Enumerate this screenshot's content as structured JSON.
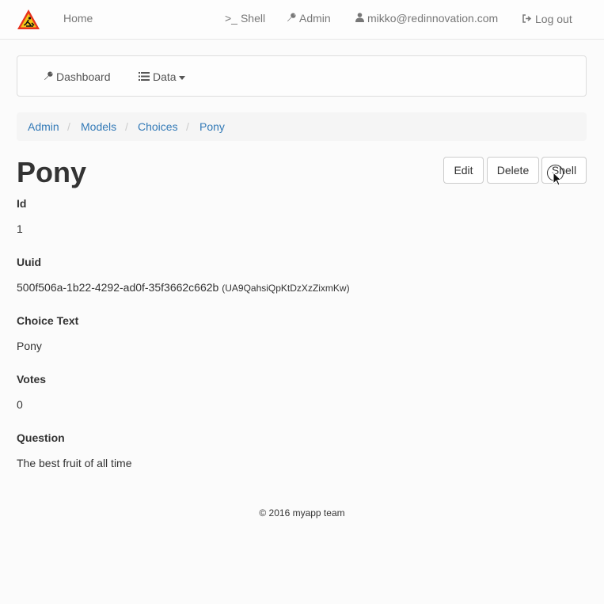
{
  "navbar": {
    "home": "Home",
    "shell": "Shell",
    "admin": "Admin",
    "user": "mikko@redinnovation.com",
    "logout": "Log out",
    "icons": {
      "logo": "construction-warning-icon",
      "shell": "terminal-icon",
      "admin": "wrench-icon",
      "user": "user-icon",
      "logout": "log-out-icon"
    }
  },
  "subnav": {
    "dashboard": "Dashboard",
    "data": "Data"
  },
  "breadcrumb": [
    "Admin",
    "Models",
    "Choices",
    "Pony"
  ],
  "page": {
    "title": "Pony",
    "buttons": {
      "edit": "Edit",
      "delete": "Delete",
      "shell": "Shell"
    }
  },
  "fields": [
    {
      "label": "Id",
      "value": "1"
    },
    {
      "label": "Uuid",
      "value": "500f506a-1b22-4292-ad0f-35f3662c662b",
      "extra": "(UA9QahsiQpKtDzXzZixmKw)"
    },
    {
      "label": "Choice Text",
      "value": "Pony"
    },
    {
      "label": "Votes",
      "value": "0"
    },
    {
      "label": "Question",
      "value": "The best fruit of all time"
    }
  ],
  "footer": "© 2016 myapp team",
  "colors": {
    "link": "#337ab7",
    "nav_text": "#777777",
    "logo_red": "#e8321e",
    "logo_yellow": "#f5c518"
  }
}
